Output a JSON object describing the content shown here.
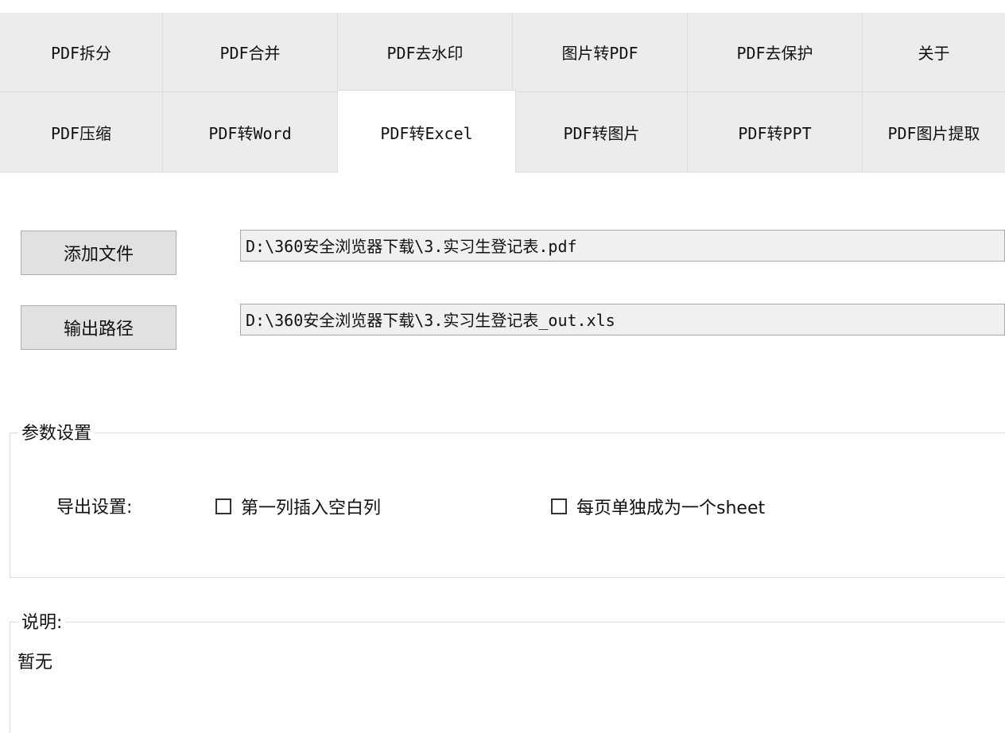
{
  "tabs": {
    "row1": [
      "PDF拆分",
      "PDF合并",
      "PDF去水印",
      "图片转PDF",
      "PDF去保护",
      "关于"
    ],
    "row2": [
      "PDF压缩",
      "PDF转Word",
      "PDF转Excel",
      "PDF转图片",
      "PDF转PPT",
      "PDF图片提取"
    ],
    "active": "PDF转Excel"
  },
  "files": {
    "add_button": "添加文件",
    "input_path": "D:\\360安全浏览器下载\\3.实习生登记表.pdf",
    "output_button": "输出路径",
    "output_path": "D:\\360安全浏览器下载\\3.实习生登记表_out.xls"
  },
  "params": {
    "legend": "参数设置",
    "export_label": "导出设置:",
    "option1": "第一列插入空白列",
    "option1_checked": false,
    "option2": "每页单独成为一个sheet",
    "option2_checked": false
  },
  "notes": {
    "legend": "说明:",
    "text": "暂无"
  }
}
